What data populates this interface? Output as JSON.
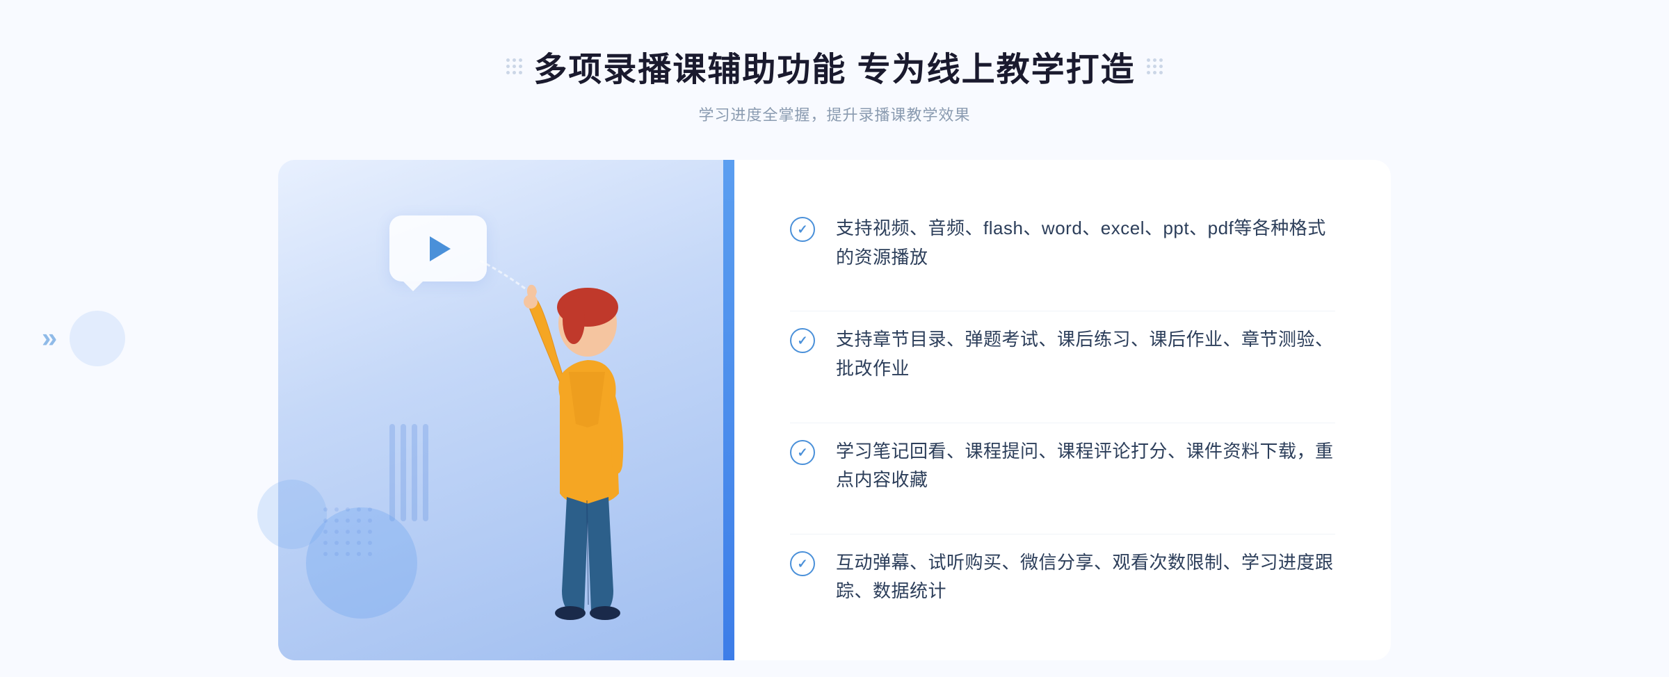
{
  "header": {
    "main_title": "多项录播课辅助功能 专为线上教学打造",
    "sub_title": "学习进度全掌握，提升录播课教学效果"
  },
  "features": [
    {
      "id": "feature-1",
      "text": "支持视频、音频、flash、word、excel、ppt、pdf等各种格式的资源播放"
    },
    {
      "id": "feature-2",
      "text": "支持章节目录、弹题考试、课后练习、课后作业、章节测验、批改作业"
    },
    {
      "id": "feature-3",
      "text": "学习笔记回看、课程提问、课程评论打分、课件资料下载，重点内容收藏"
    },
    {
      "id": "feature-4",
      "text": "互动弹幕、试听购买、微信分享、观看次数限制、学习进度跟踪、数据统计"
    }
  ],
  "decorative": {
    "chevron_left": "»",
    "play_icon": "▶"
  },
  "colors": {
    "accent_blue": "#4a90d9",
    "light_blue": "#5b9ef0",
    "title_dark": "#1a1a2e",
    "text_gray": "#8a9bb0",
    "feature_text": "#2c3e5a",
    "bg_light": "#f8faff"
  }
}
